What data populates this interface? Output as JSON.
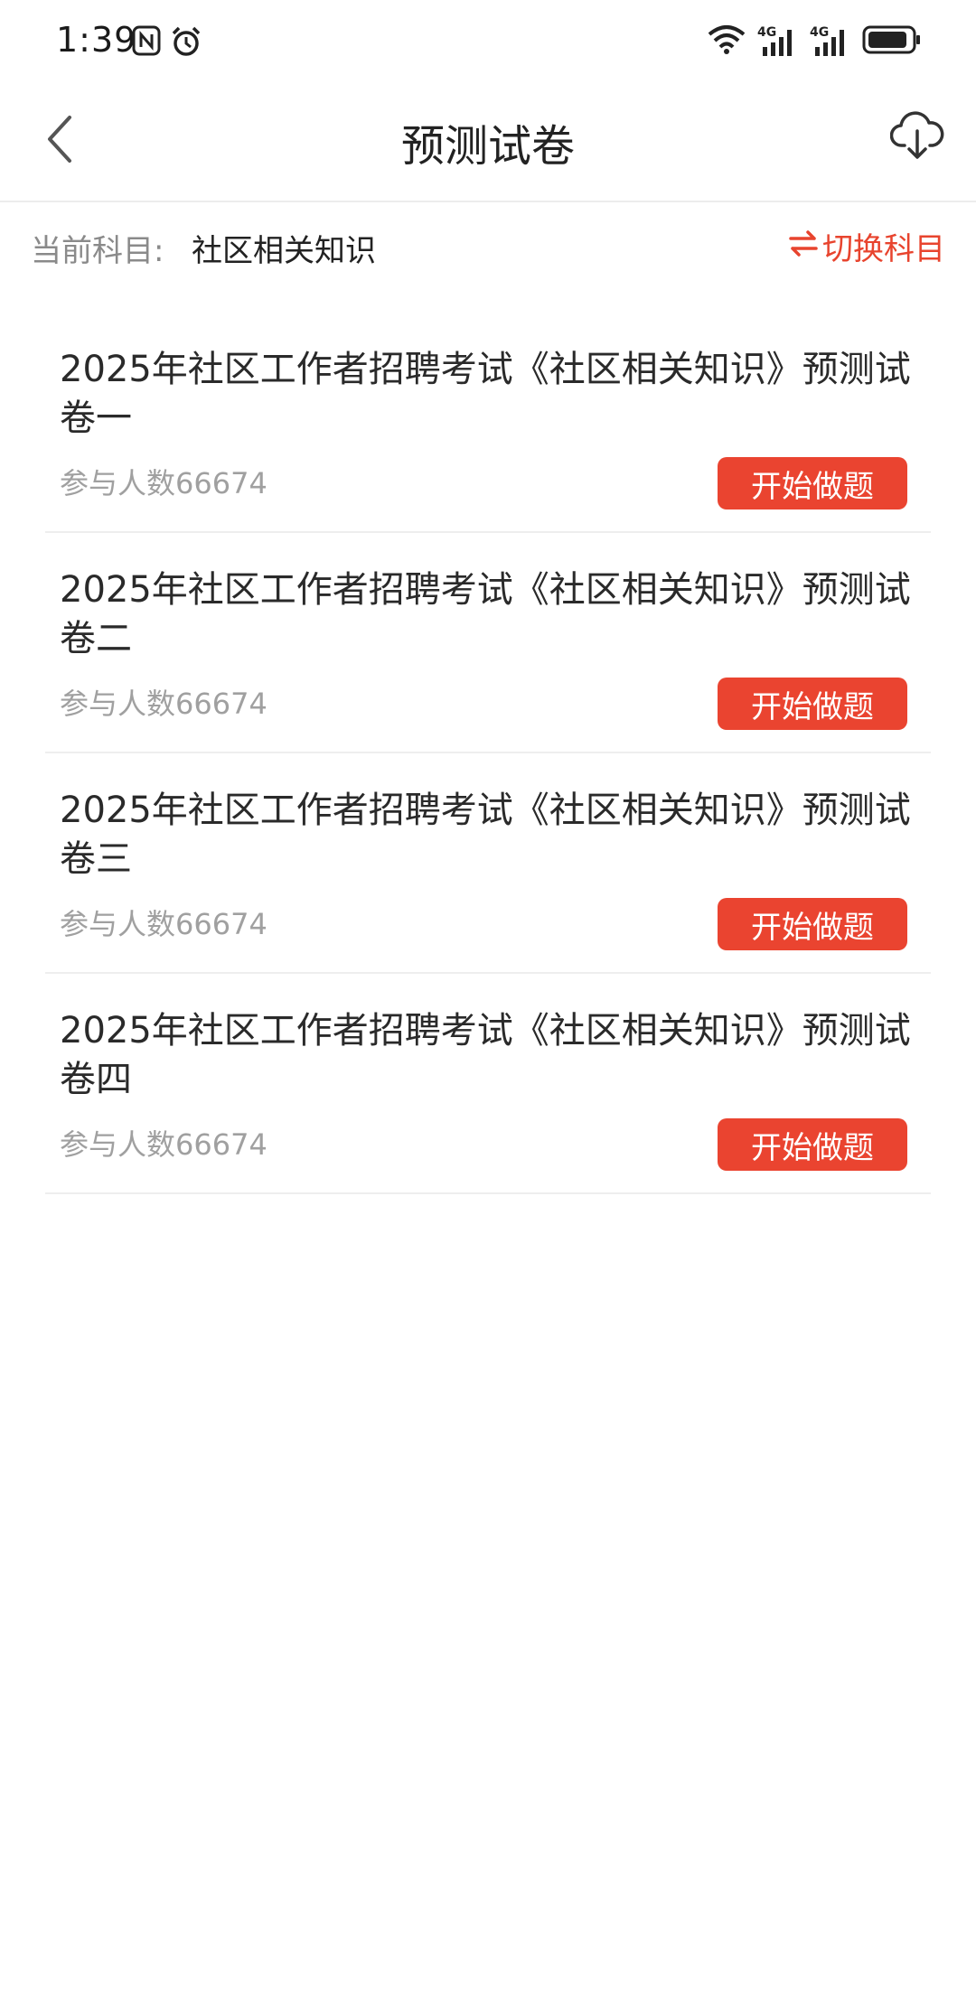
{
  "status_bar": {
    "time": "1:39",
    "icons": [
      "nfc-icon",
      "alarm-icon",
      "wifi-icon",
      "signal-4g-icon",
      "signal-4g-icon",
      "battery-icon"
    ],
    "network_label_1": "4G",
    "network_label_2": "4G"
  },
  "nav": {
    "title": "预测试卷",
    "back_icon": "chevron-left-icon",
    "download_icon": "cloud-download-icon"
  },
  "subject": {
    "label": "当前科目:",
    "value": "社区相关知识",
    "switch_label": "切换科目",
    "switch_icon": "swap-arrows-icon"
  },
  "colors": {
    "accent": "#ea4430",
    "muted": "#a0a0a0"
  },
  "papers": [
    {
      "title": "2025年社区工作者招聘考试《社区相关知识》预测试卷一",
      "participants": "参与人数66674",
      "button": "开始做题"
    },
    {
      "title": "2025年社区工作者招聘考试《社区相关知识》预测试卷二",
      "participants": "参与人数66674",
      "button": "开始做题"
    },
    {
      "title": "2025年社区工作者招聘考试《社区相关知识》预测试卷三",
      "participants": "参与人数66674",
      "button": "开始做题"
    },
    {
      "title": "2025年社区工作者招聘考试《社区相关知识》预测试卷四",
      "participants": "参与人数66674",
      "button": "开始做题"
    }
  ]
}
